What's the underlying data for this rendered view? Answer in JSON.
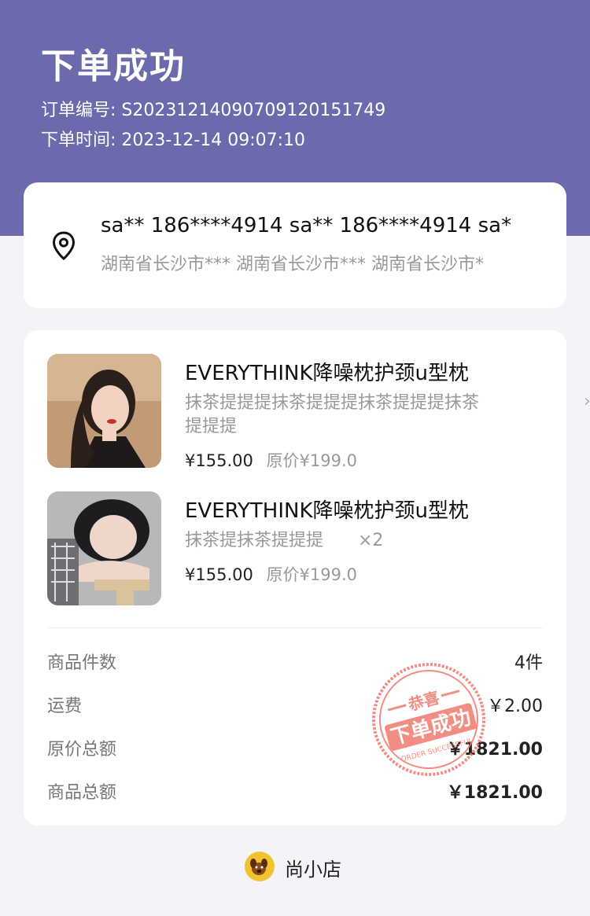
{
  "header": {
    "title": "下单成功",
    "order_no": "订单编号: S20231214090709120151749",
    "order_time": "下单时间: 2023-12-14 09:07:10"
  },
  "address": {
    "icon": "location-pin-icon",
    "name_phone": "sa** 186****4914 sa** 186****4914 sa*",
    "detail": "湖南省长沙市*** 湖南省长沙市*** 湖南省长沙市*"
  },
  "goods": [
    {
      "name": "EVERYTHINK降噪枕护颈u型枕",
      "spec": "抹茶提提提抹茶提提提抹茶提提提抹茶提提提",
      "qty": "",
      "price": "¥155.00",
      "orig_price": "原价¥199.0"
    },
    {
      "name": "EVERYTHINK降噪枕护颈u型枕",
      "spec": "抹茶提抹茶提提提",
      "qty": "×2",
      "price": "¥155.00",
      "orig_price": "原价¥199.0"
    }
  ],
  "summary": {
    "count_label": "商品件数",
    "count_value": "4件",
    "shipping_label": "运费",
    "shipping_value": "￥2.00",
    "orig_total_label": "原价总额",
    "orig_total_value": "￥1821.00",
    "goods_total_label": "商品总额",
    "goods_total_value": "￥1821.00"
  },
  "stamp": {
    "top_text": "恭喜",
    "main_text": "下单成功",
    "sub_text": "ORDER SUCCESSFUL"
  },
  "footer": {
    "shop_name": "尚小店"
  },
  "colors": {
    "header_bg": "#6a6aad",
    "stamp": "#f07a6e"
  }
}
